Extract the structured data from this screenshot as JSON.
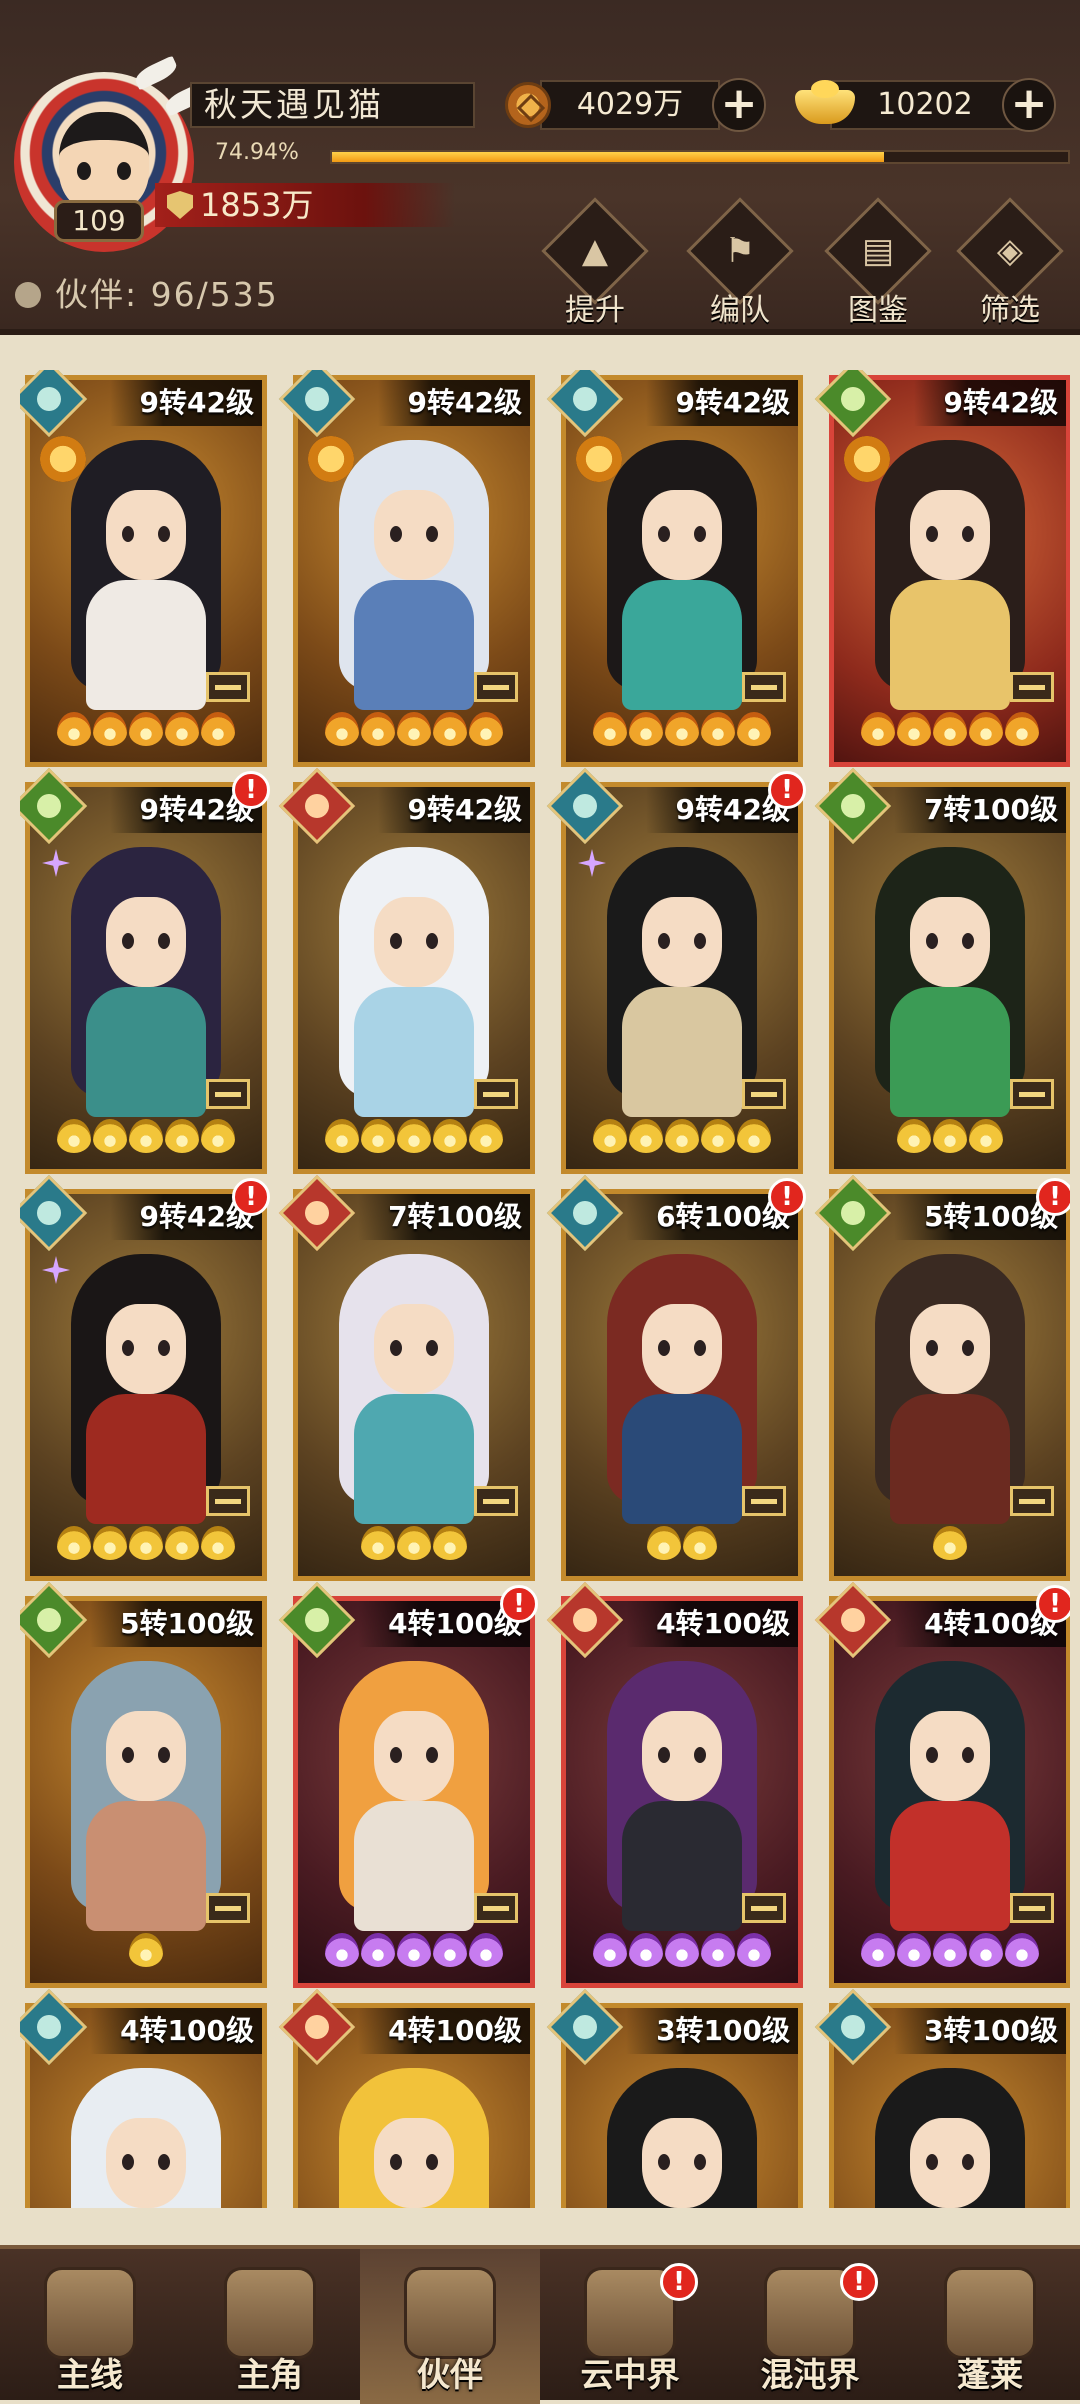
{
  "player": {
    "name": "秋天遇见猫",
    "level": "109",
    "exp_percent_text": "74.94%",
    "exp_fraction": 0.7494,
    "power": "1853万"
  },
  "resources": {
    "coins": "4029万",
    "ingots": "10202",
    "plus": "+"
  },
  "partners": {
    "label": "伙伴:",
    "count": "96/535"
  },
  "tools": [
    {
      "label": "提升",
      "icon": "upgrade-icon",
      "glyph": "▲"
    },
    {
      "label": "编队",
      "icon": "formation-icon",
      "glyph": "⚑"
    },
    {
      "label": "图鉴",
      "icon": "codex-icon",
      "glyph": "▤"
    },
    {
      "label": "筛选",
      "icon": "filter-icon",
      "glyph": "◈"
    }
  ],
  "cards": [
    {
      "rank": "9转42级",
      "element": "teal",
      "frame": "gold",
      "stars": 5,
      "star_color": "orange",
      "alert": false,
      "hair": "#1f1d24",
      "body": "#efeae4"
    },
    {
      "rank": "9转42级",
      "element": "teal",
      "frame": "gold",
      "stars": 5,
      "star_color": "orange",
      "alert": false,
      "hair": "#dfe5ee",
      "body": "#5a7fb8"
    },
    {
      "rank": "9转42级",
      "element": "teal",
      "frame": "gold",
      "stars": 5,
      "star_color": "orange",
      "alert": false,
      "hair": "#1c1818",
      "body": "#3aa79a"
    },
    {
      "rank": "9转42级",
      "element": "green",
      "frame": "red",
      "stars": 5,
      "star_color": "orange",
      "alert": false,
      "hair": "#2a1e1a",
      "body": "#e8c46a"
    },
    {
      "rank": "9转42级",
      "element": "green",
      "frame": "gold",
      "stars": 5,
      "star_color": "gold",
      "alert": true,
      "hair": "#2b2440",
      "body": "#3b8f8a"
    },
    {
      "rank": "9转42级",
      "element": "red",
      "frame": "gold",
      "stars": 5,
      "star_color": "gold",
      "alert": false,
      "hair": "#eef1f5",
      "body": "#a9d3e6"
    },
    {
      "rank": "9转42级",
      "element": "teal",
      "frame": "gold",
      "stars": 5,
      "star_color": "gold",
      "alert": true,
      "hair": "#1a1a1a",
      "body": "#d9c7a0"
    },
    {
      "rank": "7转100级",
      "element": "green",
      "frame": "gold",
      "stars": 3,
      "star_color": "gold",
      "alert": false,
      "hair": "#1d2418",
      "body": "#3b9b55"
    },
    {
      "rank": "9转42级",
      "element": "teal",
      "frame": "gold",
      "stars": 5,
      "star_color": "gold",
      "alert": true,
      "hair": "#1a1616",
      "body": "#9e2a20"
    },
    {
      "rank": "7转100级",
      "element": "red",
      "frame": "gold",
      "stars": 3,
      "star_color": "gold",
      "alert": false,
      "hair": "#e6e2ec",
      "body": "#4fa8b0"
    },
    {
      "rank": "6转100级",
      "element": "teal",
      "frame": "gold",
      "stars": 2,
      "star_color": "gold",
      "alert": true,
      "hair": "#7b2a22",
      "body": "#2a4a78"
    },
    {
      "rank": "5转100级",
      "element": "green",
      "frame": "gold",
      "stars": 1,
      "star_color": "gold",
      "alert": true,
      "hair": "#3a2a22",
      "body": "#6b2a20"
    },
    {
      "rank": "5转100级",
      "element": "green",
      "frame": "gold",
      "stars": 1,
      "star_color": "gold",
      "alert": false,
      "hair": "#8aa2b0",
      "body": "#c98f72"
    },
    {
      "rank": "4转100级",
      "element": "green",
      "frame": "red",
      "stars": 5,
      "star_color": "purple",
      "alert": true,
      "hair": "#f0a040",
      "body": "#e9e0d4"
    },
    {
      "rank": "4转100级",
      "element": "red",
      "frame": "red",
      "stars": 5,
      "star_color": "purple",
      "alert": false,
      "hair": "#5a2a6e",
      "body": "#2a2a32"
    },
    {
      "rank": "4转100级",
      "element": "red",
      "frame": "gold",
      "stars": 5,
      "star_color": "purple",
      "alert": true,
      "hair": "#1c2a30",
      "body": "#c2302a"
    },
    {
      "rank": "4转100级",
      "element": "teal",
      "frame": "gold",
      "stars": 0,
      "star_color": "gold",
      "alert": false,
      "hair": "#e8edf2",
      "body": "#dfe6ee"
    },
    {
      "rank": "4转100级",
      "element": "red",
      "frame": "gold",
      "stars": 0,
      "star_color": "gold",
      "alert": false,
      "hair": "#f2c23a",
      "body": "#b87a1a"
    },
    {
      "rank": "3转100级",
      "element": "teal",
      "frame": "gold",
      "stars": 0,
      "star_color": "gold",
      "alert": false,
      "hair": "#1a1a1a",
      "body": "#3a4a52"
    },
    {
      "rank": "3转100级",
      "element": "teal",
      "frame": "gold",
      "stars": 0,
      "star_color": "gold",
      "alert": false,
      "hair": "#1a1a1a",
      "body": "#3a4a52"
    }
  ],
  "nav": [
    {
      "label": "主线",
      "icon": "main-quest-icon",
      "active": false,
      "alert": false
    },
    {
      "label": "主角",
      "icon": "hero-icon",
      "active": false,
      "alert": false
    },
    {
      "label": "伙伴",
      "icon": "partner-icon",
      "active": true,
      "alert": false
    },
    {
      "label": "云中界",
      "icon": "cloud-realm-icon",
      "active": false,
      "alert": true
    },
    {
      "label": "混沌界",
      "icon": "chaos-realm-icon",
      "active": false,
      "alert": true
    },
    {
      "label": "蓬莱",
      "icon": "penglai-icon",
      "active": false,
      "alert": false
    }
  ],
  "alert_mark": "!"
}
